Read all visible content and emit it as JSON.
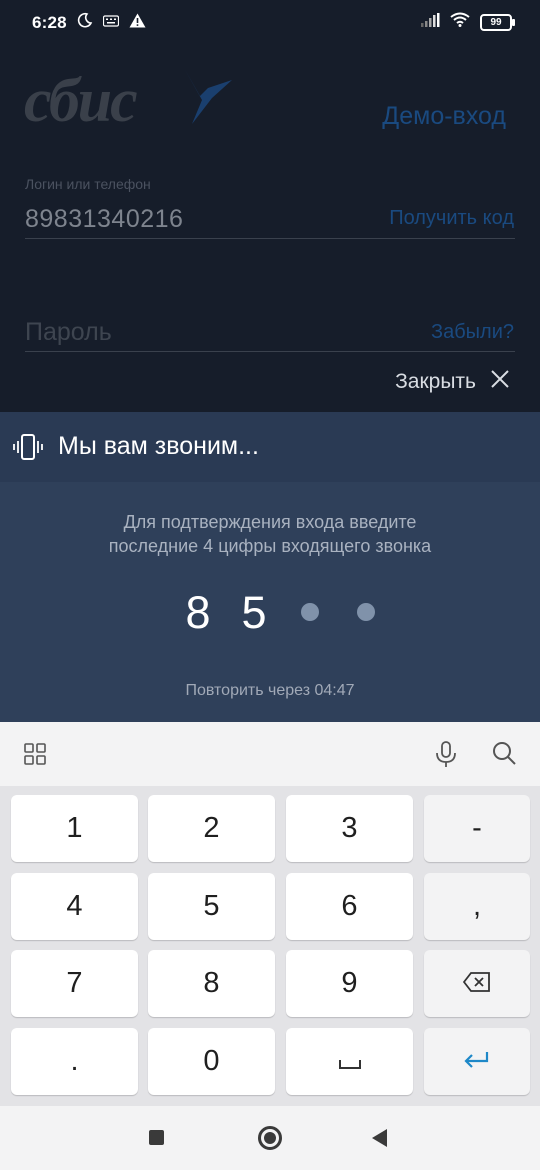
{
  "status_bar": {
    "time": "6:28",
    "battery": "99",
    "icons": [
      "moon-icon",
      "keyboard-notify-icon",
      "warning-icon",
      "signal-icon",
      "wifi-icon",
      "battery-icon"
    ]
  },
  "login": {
    "logo_text": "сбис",
    "demo_link": "Демо-вход",
    "login_label": "Логин или телефон",
    "login_value": "89831340216",
    "get_code": "Получить код",
    "password_placeholder": "Пароль",
    "forgot": "Забыли?",
    "close_label": "Закрыть"
  },
  "call_panel": {
    "title": "Мы вам звоним...",
    "instruction_line1": "Для подтверждения входа введите",
    "instruction_line2": "последние 4 цифры входящего звонка",
    "digits": [
      "8",
      "5",
      "",
      ""
    ],
    "repeat_text": "Повторить через 04:47"
  },
  "keyboard": {
    "rows": [
      [
        "1",
        "2",
        "3",
        "-"
      ],
      [
        "4",
        "5",
        "6",
        ","
      ],
      [
        "7",
        "8",
        "9",
        "backspace"
      ],
      [
        ".",
        "0",
        "␣",
        "enter"
      ]
    ]
  },
  "colors": {
    "background": "#161d2a",
    "panel": "#2f405a",
    "panel_header": "#2a3a54",
    "link": "#1a4a80",
    "enter_key": "#1e88c8"
  }
}
